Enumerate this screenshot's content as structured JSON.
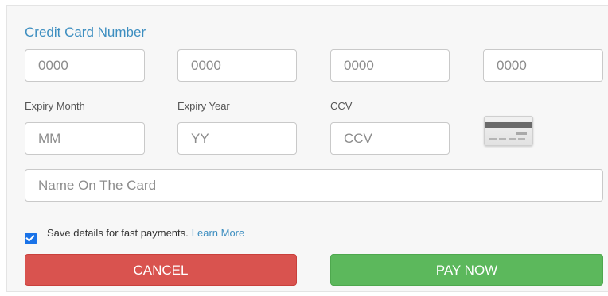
{
  "form": {
    "title": "Credit Card Number",
    "card_number_placeholders": [
      "0000",
      "0000",
      "0000",
      "0000"
    ],
    "expiry_month_label": "Expiry Month",
    "expiry_month_placeholder": "MM",
    "expiry_year_label": "Expiry Year",
    "expiry_year_placeholder": "YY",
    "ccv_label": "CCV",
    "ccv_placeholder": "CCV",
    "card_icon": "credit-card-back-icon",
    "name_placeholder": "Name On The Card",
    "save_details": {
      "checked": true,
      "label": "Save details for fast payments.",
      "link": "Learn More"
    },
    "cancel_label": "CANCEL",
    "pay_label": "PAY NOW"
  },
  "colors": {
    "accent": "#3d8ec0",
    "cancel": "#d9534f",
    "pay": "#5cb85c",
    "checkbox": "#1a73e8"
  }
}
